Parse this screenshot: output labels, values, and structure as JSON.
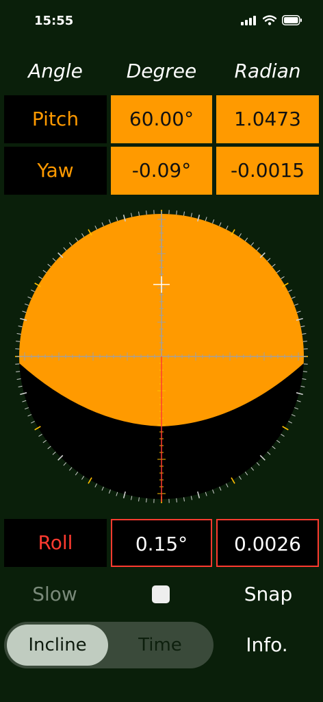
{
  "status": {
    "time": "15:55"
  },
  "headers": {
    "angle": "Angle",
    "degree": "Degree",
    "radian": "Radian"
  },
  "pitch": {
    "label": "Pitch",
    "degree": "60.00°",
    "radian": "1.0473"
  },
  "yaw": {
    "label": "Yaw",
    "degree": "-0.09°",
    "radian": "-0.0015"
  },
  "roll": {
    "label": "Roll",
    "degree": "0.15°",
    "radian": "0.0026"
  },
  "controls": {
    "slow": "Slow",
    "snap": "Snap",
    "info": "Info."
  },
  "mode": {
    "options": [
      "Incline",
      "Time"
    ],
    "selected": "Incline"
  },
  "colors": {
    "accent": "#ff9a00",
    "roll_accent": "#ff3b30",
    "background": "#0a1f0a"
  },
  "icons": [
    "signal-icon",
    "wifi-icon",
    "battery-icon"
  ]
}
